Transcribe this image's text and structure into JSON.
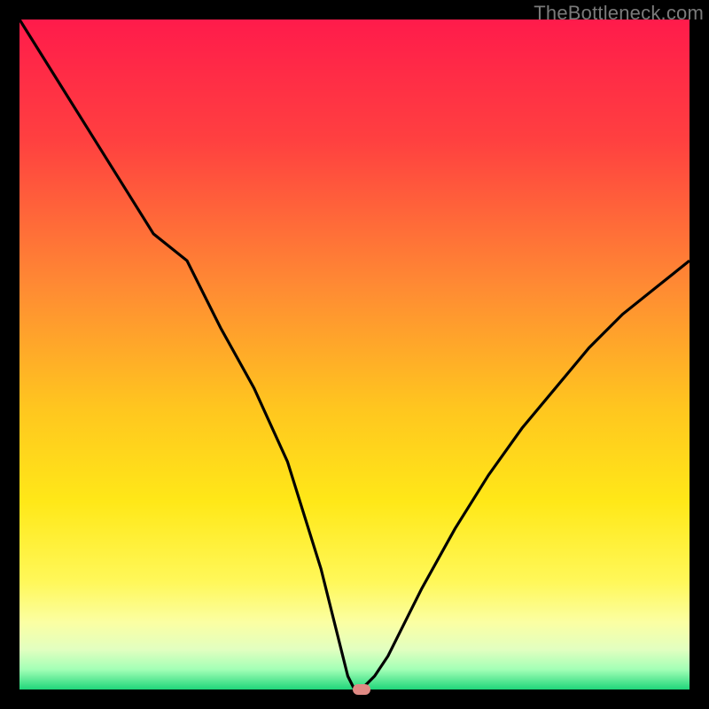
{
  "watermark": "TheBottleneck.com",
  "chart_data": {
    "type": "line",
    "title": "",
    "xlabel": "",
    "ylabel": "",
    "xlim": [
      0,
      100
    ],
    "ylim": [
      0,
      100
    ],
    "grid": false,
    "legend": false,
    "series": [
      {
        "name": "bottleneck-curve",
        "x": [
          0,
          5,
          10,
          15,
          20,
          25,
          30,
          35,
          40,
          45,
          48,
          49,
          50,
          51,
          52,
          53,
          55,
          58,
          60,
          65,
          70,
          75,
          80,
          85,
          90,
          95,
          100
        ],
        "values": [
          100,
          92,
          84,
          76,
          68,
          64,
          54,
          45,
          34,
          18,
          6,
          2,
          0,
          0,
          1,
          2,
          5,
          11,
          15,
          24,
          32,
          39,
          45,
          51,
          56,
          60,
          64
        ]
      }
    ],
    "marker": {
      "x": 51,
      "y": 0,
      "color": "#e08a84"
    },
    "gradient_stops": [
      {
        "pct": 0,
        "color": "#ff1b4b"
      },
      {
        "pct": 18,
        "color": "#ff4040"
      },
      {
        "pct": 40,
        "color": "#ff8b33"
      },
      {
        "pct": 58,
        "color": "#ffc61f"
      },
      {
        "pct": 72,
        "color": "#ffe818"
      },
      {
        "pct": 84,
        "color": "#fff85a"
      },
      {
        "pct": 90,
        "color": "#fbffa3"
      },
      {
        "pct": 94,
        "color": "#e2ffc0"
      },
      {
        "pct": 97,
        "color": "#a3ffb6"
      },
      {
        "pct": 100,
        "color": "#1fd67a"
      }
    ]
  }
}
